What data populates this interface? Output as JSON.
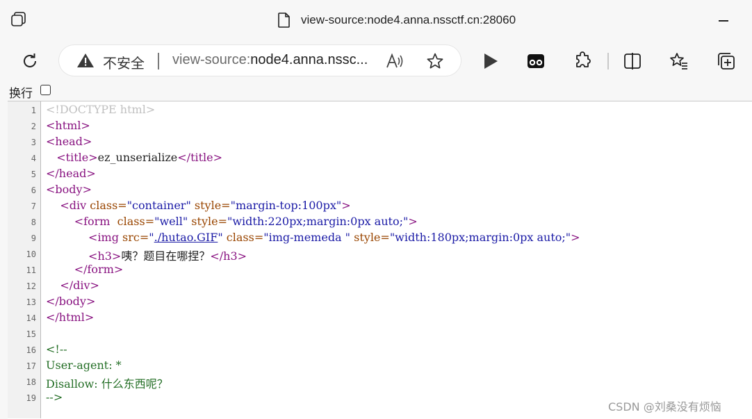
{
  "window": {
    "title": "view-source:node4.anna.nssctf.cn:28060"
  },
  "address_bar": {
    "security_label": "不安全",
    "url_prefix": "view-source:",
    "url_rest": "node4.anna.nssc..."
  },
  "wrap": {
    "label": "换行",
    "checked": false
  },
  "source": {
    "line_numbers": [
      "1",
      "2",
      "3",
      "4",
      "5",
      "6",
      "7",
      "8",
      "9",
      "10",
      "11",
      "12",
      "13",
      "14",
      "15",
      "16",
      "17",
      "18",
      "19"
    ],
    "l1": {
      "doctype": "<!DOCTYPE html>"
    },
    "l2": {
      "tag": "<html>"
    },
    "l3": {
      "tag": "<head>"
    },
    "l4": {
      "open": "<title>",
      "text": "ez_unserialize",
      "close": "</title>"
    },
    "l5": {
      "tag": "</head>"
    },
    "l6": {
      "tag": "<body>"
    },
    "l7": {
      "open": "<div",
      "a1": " class=",
      "v1": "\"container\"",
      "a2": " style=",
      "v2": "\"margin-top:100px\"",
      "end": ">"
    },
    "l8": {
      "open": "<form ",
      "a1": " class=",
      "v1": "\"well\"",
      "a2": " style=",
      "v2": "\"width:220px;margin:0px auto;\"",
      "end": ">"
    },
    "l9": {
      "open": "<img",
      "a1": " src=",
      "q1": "\"",
      "link": "./hutao.GIF",
      "q2": "\"",
      "a2": " class=",
      "v2": "\"img-memeda \"",
      "a3": " style=",
      "v3": "\"width:180px;margin:0px auto;\"",
      "end": ">"
    },
    "l10": {
      "open": "<h3>",
      "text": "咦？题目在哪捏？",
      "close": "</h3>"
    },
    "l11": {
      "tag": "</form>"
    },
    "l12": {
      "tag": "</div>"
    },
    "l13": {
      "tag": "</body>"
    },
    "l14": {
      "tag": "</html>"
    },
    "l16": {
      "comment": "<!--"
    },
    "l17": {
      "comment": "User-agent: *"
    },
    "l18": {
      "comment": "Disallow: 什么东西呢？"
    },
    "l19": {
      "comment": "-->"
    }
  },
  "watermark": "CSDN @刘桑没有烦恼",
  "icons": [
    "tabs-icon",
    "document-icon",
    "minimize-icon",
    "refresh-icon",
    "warning-icon",
    "read-aloud-icon",
    "favorite-star-icon",
    "play-icon",
    "extension-game-icon",
    "puzzle-icon",
    "split-screen-icon",
    "favorites-list-icon",
    "add-collection-icon"
  ]
}
